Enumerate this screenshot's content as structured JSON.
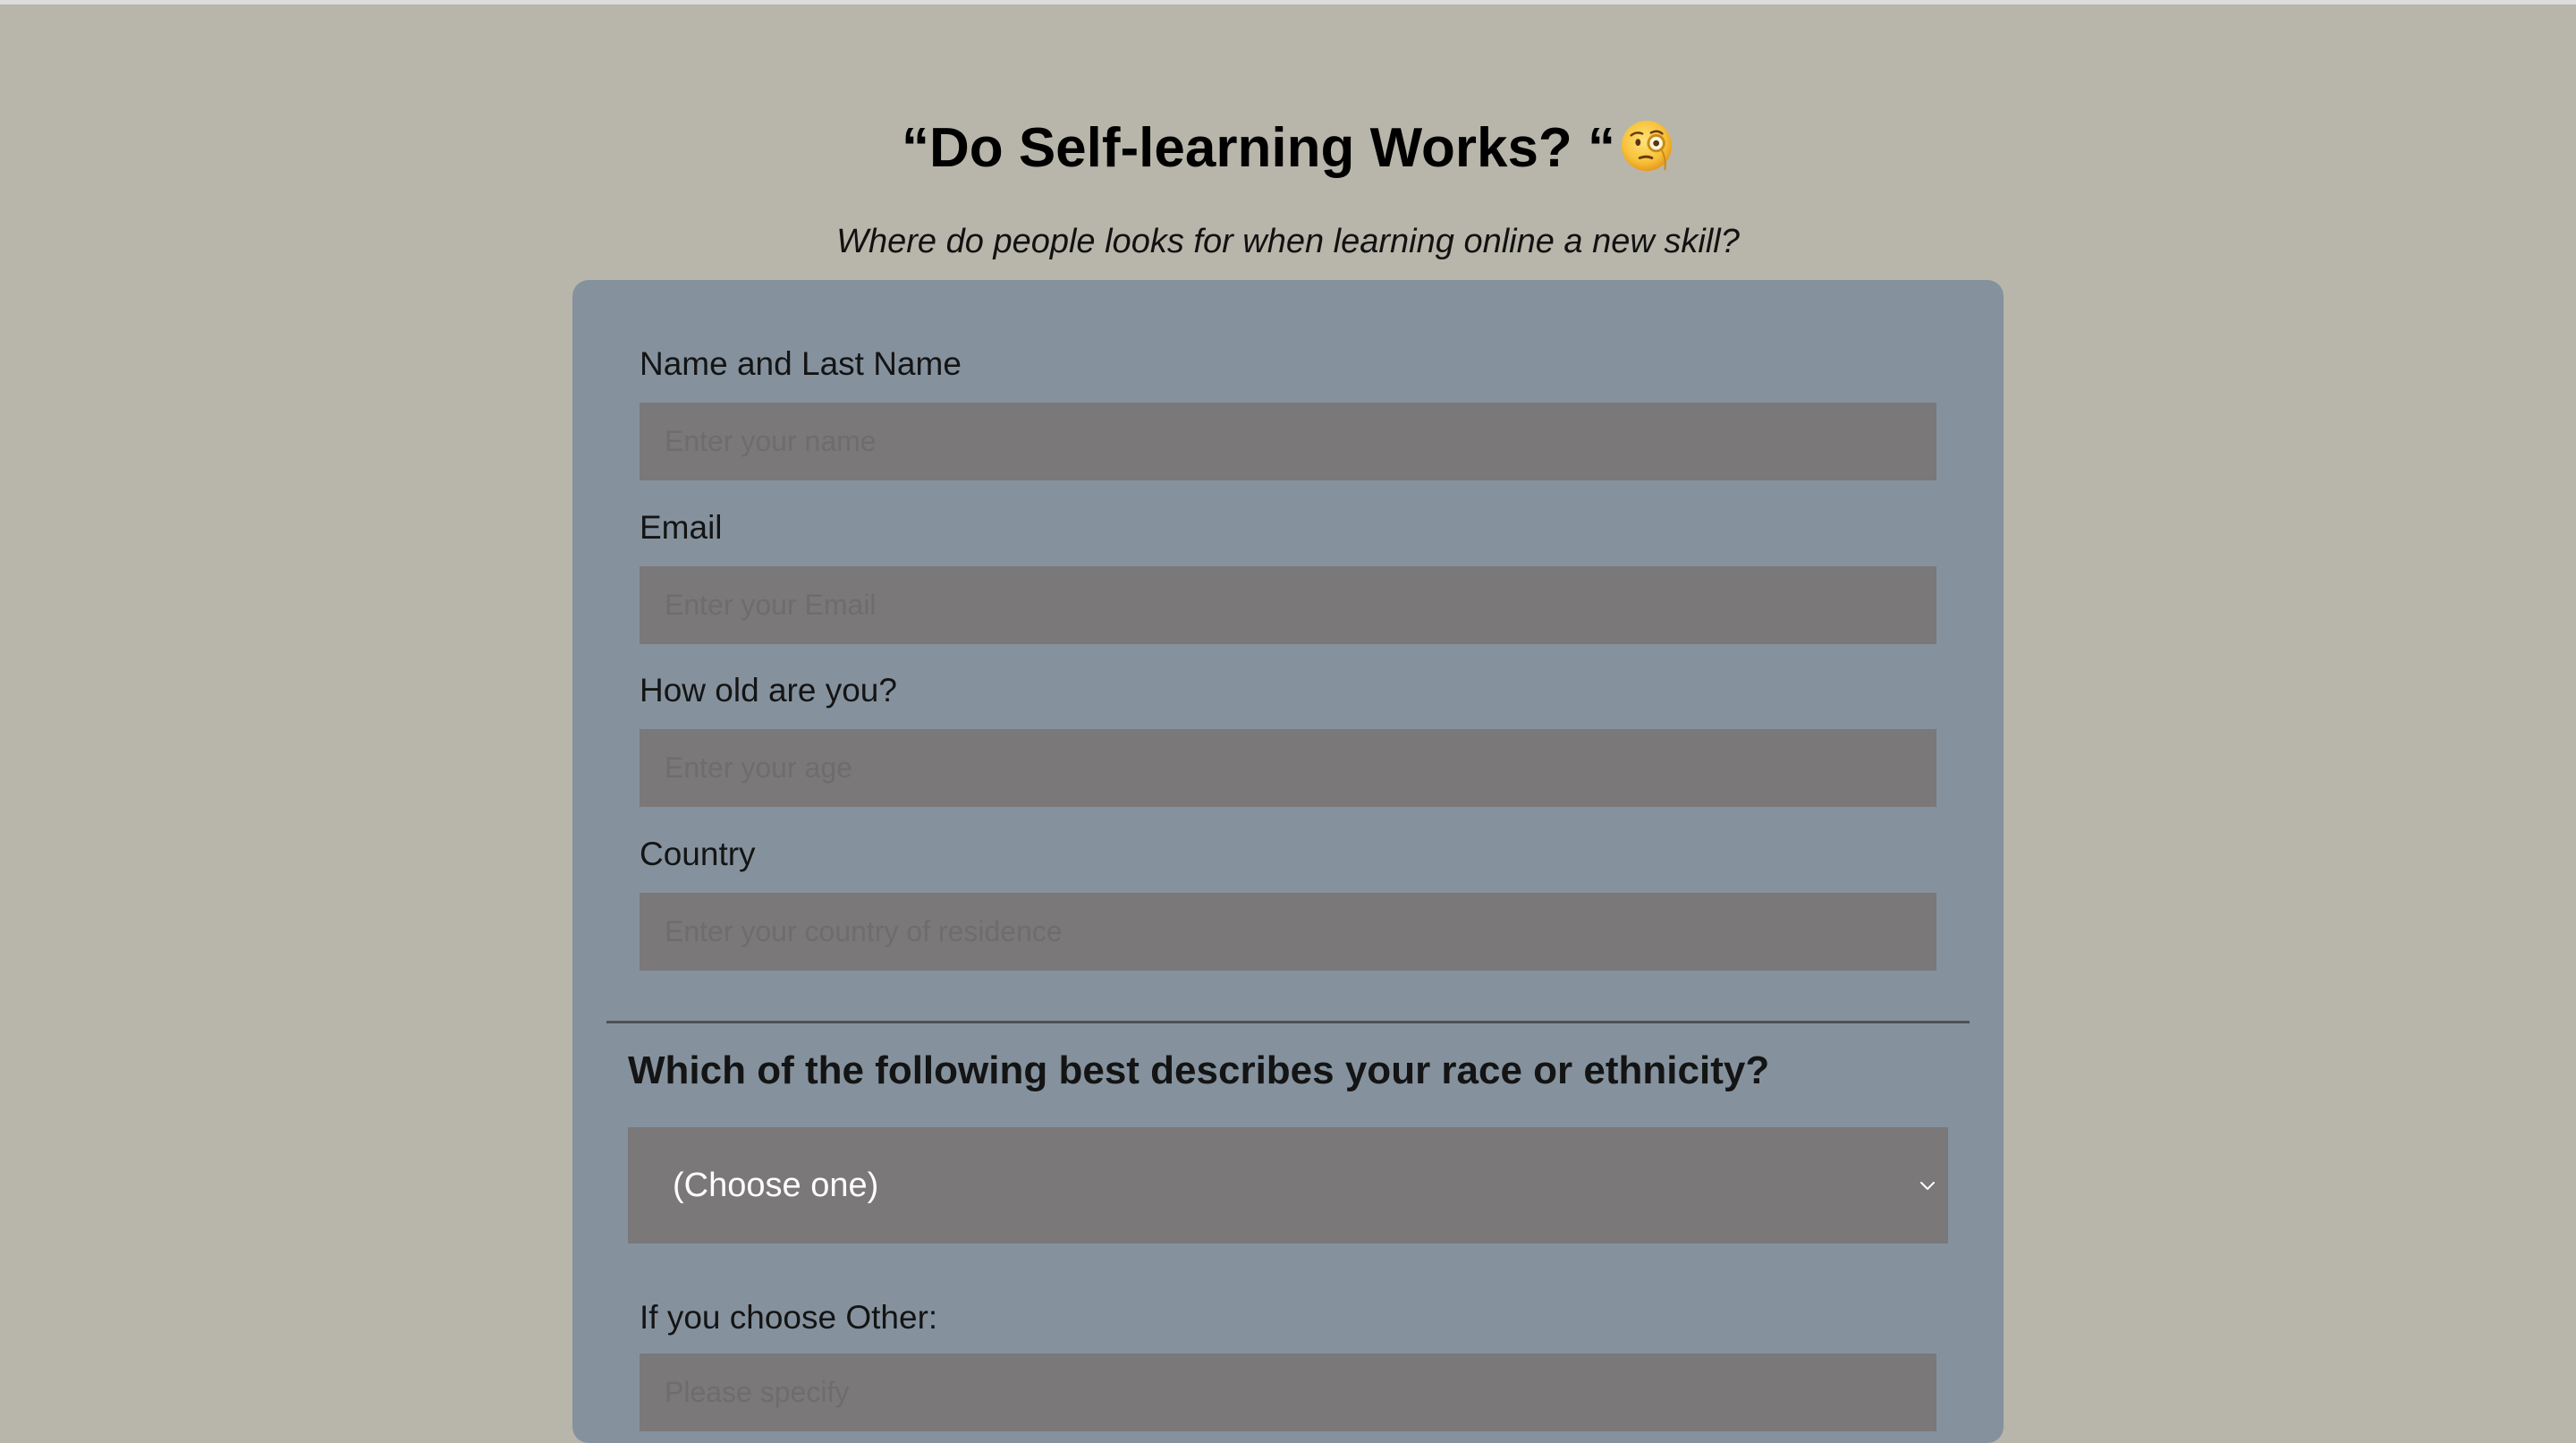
{
  "header": {
    "title": "“Do Self-learning Works? “",
    "title_emoji": "face-with-monocle-icon",
    "subtitle": "Where do people looks for when learning online a new skill?"
  },
  "form": {
    "name": {
      "label": "Name and Last Name",
      "placeholder": "Enter your name",
      "value": ""
    },
    "email": {
      "label": "Email",
      "placeholder": "Enter your Email",
      "value": ""
    },
    "age": {
      "label": "How old are you?",
      "placeholder": "Enter your age",
      "value": ""
    },
    "country": {
      "label": "Country",
      "placeholder": "Enter your country of residence",
      "value": ""
    },
    "race_question": "Which of the following best describes your race or ethnicity?",
    "race_select": {
      "selected": "(Choose one)"
    },
    "other": {
      "label": "If you choose Other:",
      "placeholder": "Please specify",
      "value": ""
    }
  },
  "colors": {
    "page_background": "#b8b6aa",
    "card_background": "#85929e",
    "input_background": "#7b7879",
    "text": "#141414",
    "select_text": "#ffffff"
  }
}
